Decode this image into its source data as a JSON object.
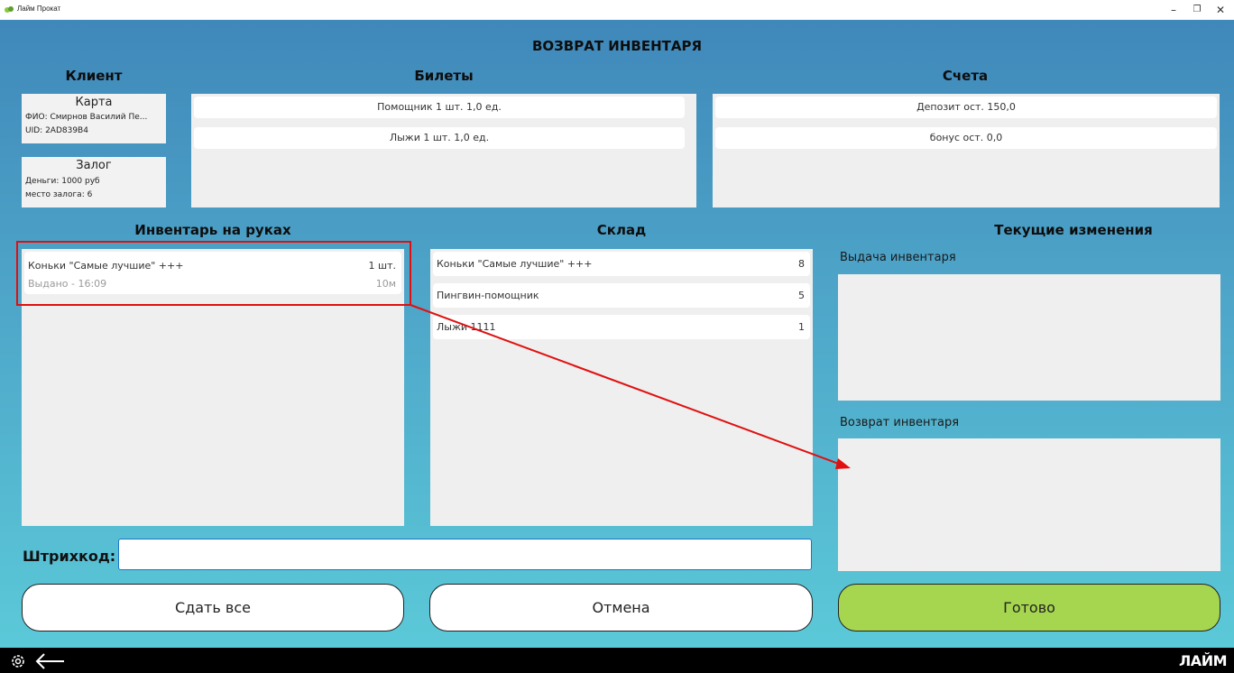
{
  "window": {
    "title": "Лайм Прокат",
    "minimize": "–",
    "restore": "❐",
    "close": "✕"
  },
  "page_title": "ВОЗВРАТ ИНВЕНТАРЯ",
  "client": {
    "heading": "Клиент",
    "card": {
      "title": "Карта",
      "name": "ФИО: Смирнов Василий Пе...",
      "uid": "UID: 2AD839B4"
    },
    "deposit": {
      "title": "Залог",
      "money": "Деньги: 1000 руб",
      "place": "место залога: 6"
    }
  },
  "tickets": {
    "heading": "Билеты",
    "items": [
      "Помощник 1 шт. 1,0 ед.",
      "Лыжи 1 шт. 1,0 ед."
    ]
  },
  "accounts": {
    "heading": "Счета",
    "items": [
      "Депозит ост. 150,0",
      "бонус ост. 0,0"
    ]
  },
  "inventory": {
    "heading": "Инвентарь на руках",
    "items": [
      {
        "name": "Коньки \"Самые лучшие\" +++",
        "qty": "1 шт.",
        "status": "Выдано  -  16:09",
        "duration": "10м"
      }
    ]
  },
  "warehouse": {
    "heading": "Склад",
    "items": [
      {
        "name": "Коньки \"Самые лучшие\" +++",
        "qty": "8"
      },
      {
        "name": "Пингвин-помощник",
        "qty": "5"
      },
      {
        "name": "Лыжи 1111",
        "qty": "1"
      }
    ]
  },
  "changes": {
    "heading": "Текущие изменения",
    "issue_label": "Выдача инвентаря",
    "return_label": "Возврат инвентаря"
  },
  "barcode": {
    "label": "Штрихкод:",
    "value": ""
  },
  "buttons": {
    "return_all": "Сдать все",
    "cancel": "Отмена",
    "done": "Готово"
  },
  "footer": {
    "logo": "ЛАЙМ"
  },
  "colors": {
    "accent_green": "#a6d64f",
    "annotation_red": "#e01010",
    "gradient_top": "#3f88ba",
    "gradient_bottom": "#5bc9d8"
  }
}
